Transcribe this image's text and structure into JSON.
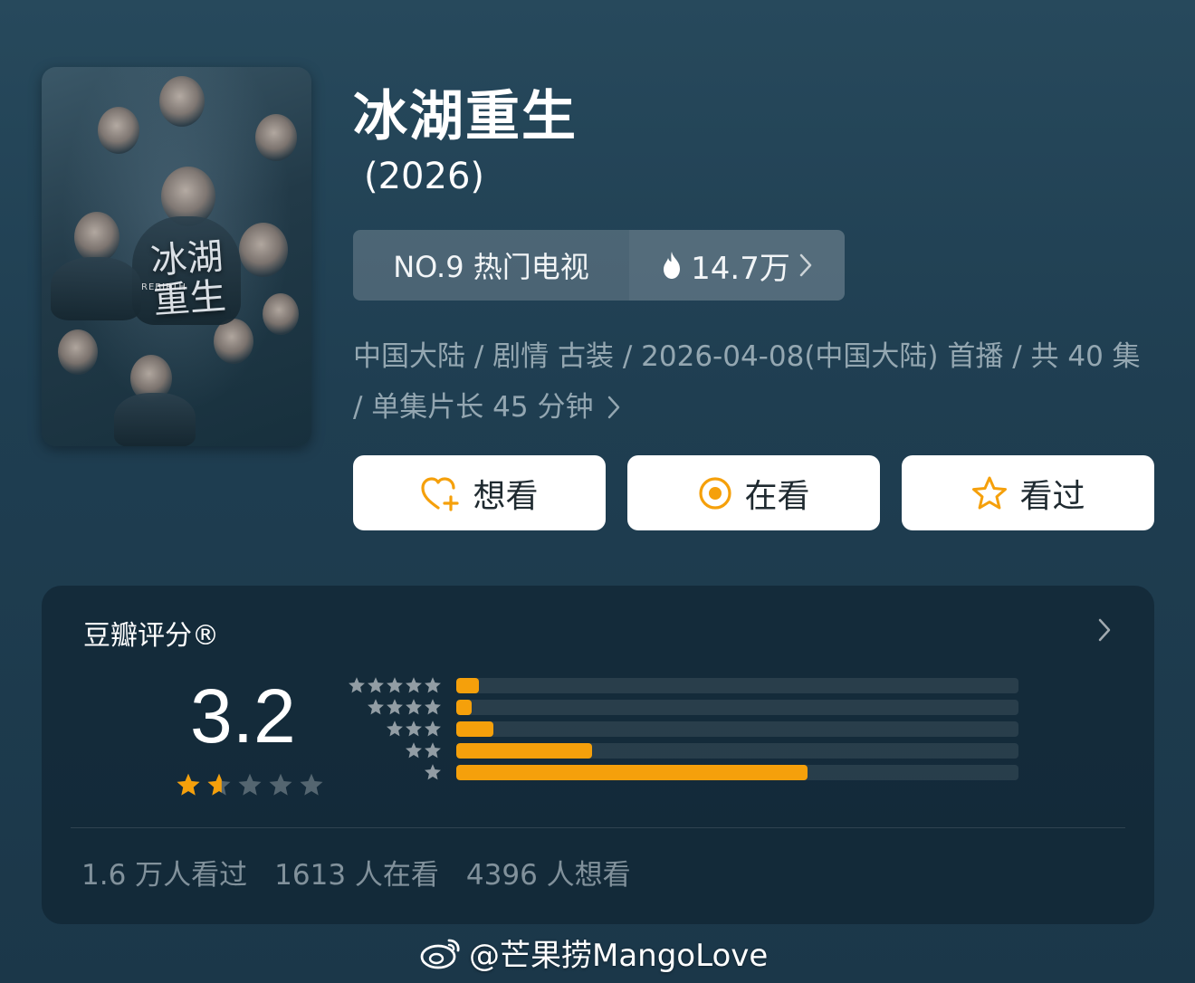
{
  "show": {
    "title": "冰湖重生",
    "year": " (2026)"
  },
  "poster": {
    "title_text": "冰湖重生",
    "subtitle_text": "REBIRTH"
  },
  "ranking": {
    "rank_label": "NO.9 热门电视",
    "heat_value": "14.7万"
  },
  "meta": {
    "info": "中国大陆 / 剧情 古装 / 2026-04-08(中国大陆) 首播 / 共 40 集 / 单集片长 45 分钟"
  },
  "actions": {
    "want": "想看",
    "watching": "在看",
    "watched": "看过"
  },
  "rating": {
    "title": "豆瓣评分®",
    "score": "3.2",
    "stars_value": 1.6,
    "distribution": [
      {
        "stars": 5,
        "fraction": 0.04
      },
      {
        "stars": 4,
        "fraction": 0.028
      },
      {
        "stars": 3,
        "fraction": 0.066
      },
      {
        "stars": 2,
        "fraction": 0.242
      },
      {
        "stars": 1,
        "fraction": 0.625
      }
    ]
  },
  "stats": {
    "watched": "1.6 万人看过",
    "watching": "1613 人在看",
    "want": "4396 人想看"
  },
  "watermark": {
    "text": "@芒果捞MangoLove"
  },
  "colors": {
    "accent": "#f5a00b",
    "background": "#22435a"
  }
}
